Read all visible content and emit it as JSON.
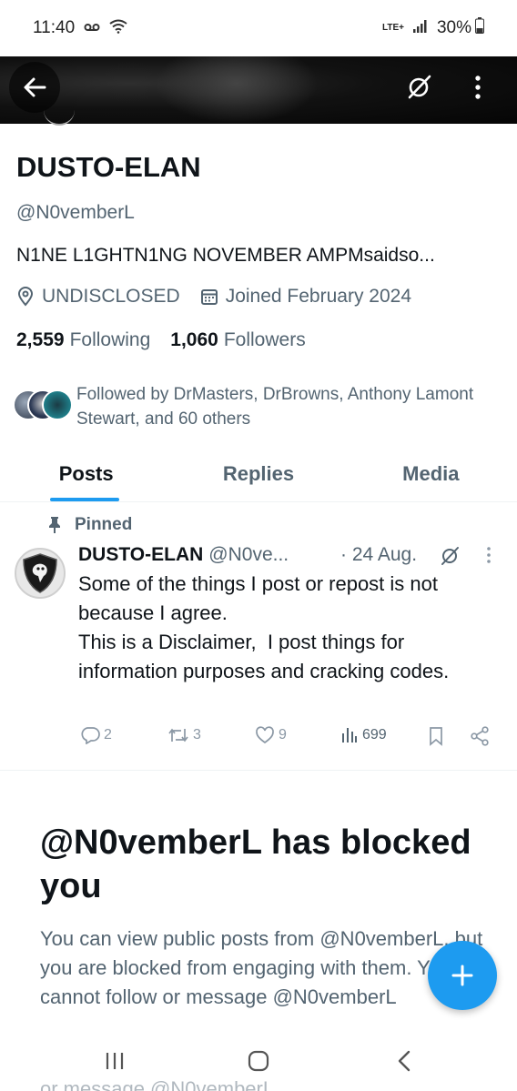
{
  "status_bar": {
    "time": "11:40",
    "network": "LTE+",
    "battery": "30%"
  },
  "profile": {
    "name": "DUSTO-ELAN",
    "handle": "@N0vemberL",
    "bio": "N1NE L1GHTN1NG NOVEMBER AMPMsaidso...",
    "location": "UNDISCLOSED",
    "joined": "Joined February 2024",
    "following_count": "2,559",
    "following_label": "Following",
    "followers_count": "1,060",
    "followers_label": "Followers",
    "followed_by_text": "Followed by DrMasters, DrBrowns, Anthony Lamont Stewart, and 60 others"
  },
  "tabs": [
    {
      "label": "Posts",
      "active": true
    },
    {
      "label": "Replies",
      "active": false
    },
    {
      "label": "Media",
      "active": false
    }
  ],
  "pinned_post": {
    "pinned_label": "Pinned",
    "author_name": "DUSTO-ELAN",
    "author_handle": "@N0ve...",
    "date": "· 24 Aug.",
    "text": "Some of the things I post or repost is not because I agree.\nThis is a Disclaimer,  I post things for information purposes and cracking codes.",
    "replies": "2",
    "reposts": "3",
    "likes": "9",
    "views": "699"
  },
  "blocked_notice": {
    "title": "@N0vemberL has blocked you",
    "message": "You can view public posts from @N0vemberL, but you are blocked from engaging with them. You also cannot follow or message @N0vemberL"
  },
  "nav_ghost_text": "or message @N0vemberL",
  "colors": {
    "accent": "#1d9bf0",
    "text_primary": "#0f1419",
    "text_secondary": "#536471"
  }
}
